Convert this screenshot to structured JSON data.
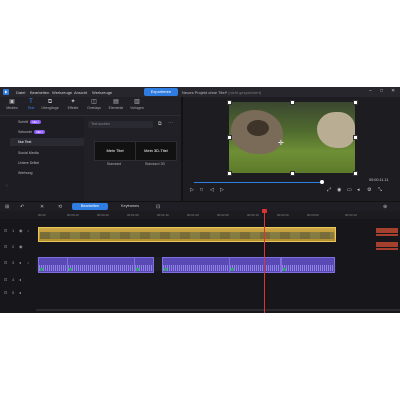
{
  "menubar": {
    "items": [
      "Datei",
      "Bearbeiten",
      "Werkzeuge",
      "Ansicht",
      "Werkzeuge"
    ],
    "export_label": "Exportieren",
    "project_title": "Neues Projekt ohne Titel*",
    "project_subtitle": "(nicht gespeichert)",
    "window_controls": [
      "–",
      "□",
      "✕"
    ]
  },
  "left_tabs": [
    {
      "label": "Medien",
      "icon": "media-icon"
    },
    {
      "label": "Text",
      "icon": "text-icon"
    },
    {
      "label": "Übergänge",
      "icon": "transitions-icon"
    },
    {
      "label": "Effekte",
      "icon": "effects-icon"
    },
    {
      "label": "Overlays",
      "icon": "overlays-icon"
    },
    {
      "label": "Elemente",
      "icon": "elements-icon"
    },
    {
      "label": "Vorlagen",
      "icon": "templates-icon"
    }
  ],
  "categories": [
    {
      "label": "Schrift",
      "badge": "NEU"
    },
    {
      "label": "Sekunde",
      "badge": "NEU"
    },
    {
      "label": "Nur Text",
      "badge": ""
    },
    {
      "label": "Social Media",
      "badge": ""
    },
    {
      "label": "Untere Drittel",
      "badge": ""
    },
    {
      "label": "Werbung",
      "badge": ""
    }
  ],
  "search_placeholder": "Text suchen",
  "tiles": [
    {
      "preview": "Mein Titel",
      "label": "Standard"
    },
    {
      "preview": "Mein 3D-Titel",
      "label": "Standard 3D"
    }
  ],
  "preview": {
    "time": "00:00:11.11",
    "progress": 0.93
  },
  "toolbar": {
    "tabs": [
      "Bearbeiten",
      "Keyframes"
    ]
  },
  "ruler_ticks": [
    "00:00",
    "00:00:10",
    "00:00:20",
    "00:01:00",
    "00:01:10",
    "00:01:20",
    "00:02:00",
    "00:02:10",
    "00:02:20",
    "00:03:00",
    "00:03:10"
  ],
  "timeline": {
    "video_clip_label": "",
    "audio_clips": [
      "",
      "",
      "",
      "",
      "",
      ""
    ]
  },
  "colors": {
    "accent": "#2f7de1",
    "video_clip": "#cda645",
    "audio_clip": "#5a4ab6",
    "playhead": "#dd3333"
  }
}
